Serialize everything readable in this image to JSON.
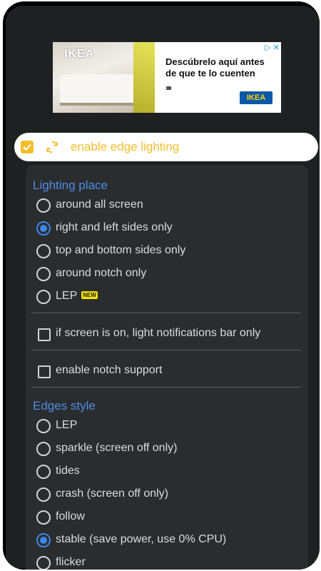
{
  "ad": {
    "brand_name": "IKEA",
    "headline": "Descúbrelo aquí antes de que te lo cuenten",
    "arrows": "›››",
    "logo": "IKEA",
    "adchoices_icon": "adchoices-icon",
    "close_icon": "close-x-icon"
  },
  "enable": {
    "checked": true,
    "label": "enable edge lighting",
    "icon": "sync-icon",
    "accent_color": "#f5be2e"
  },
  "lighting_place": {
    "title": "Lighting place",
    "options": [
      {
        "label": "around all screen",
        "selected": false
      },
      {
        "label": "right and left sides only",
        "selected": true
      },
      {
        "label": "top and bottom sides only",
        "selected": false
      },
      {
        "label": "around notch only",
        "selected": false
      },
      {
        "label": "LEP",
        "selected": false,
        "badge": "NEW"
      }
    ]
  },
  "checks": {
    "notifications_bar": {
      "label": "if screen is on, light notifications bar only",
      "checked": false
    },
    "notch_support": {
      "label": "enable notch support",
      "checked": false
    }
  },
  "edges_style": {
    "title": "Edges style",
    "options": [
      {
        "label": "LEP",
        "selected": false
      },
      {
        "label": "sparkle (screen off only)",
        "selected": false
      },
      {
        "label": "tides",
        "selected": false
      },
      {
        "label": "crash (screen off only)",
        "selected": false
      },
      {
        "label": "follow",
        "selected": false
      },
      {
        "label": "stable (save power, use 0% CPU)",
        "selected": true
      },
      {
        "label": "flicker",
        "selected": false
      }
    ]
  },
  "colors": {
    "section_title": "#4b8ee6",
    "radio_selected": "#3d86e6",
    "panel_bg": "#2b2c2e"
  }
}
